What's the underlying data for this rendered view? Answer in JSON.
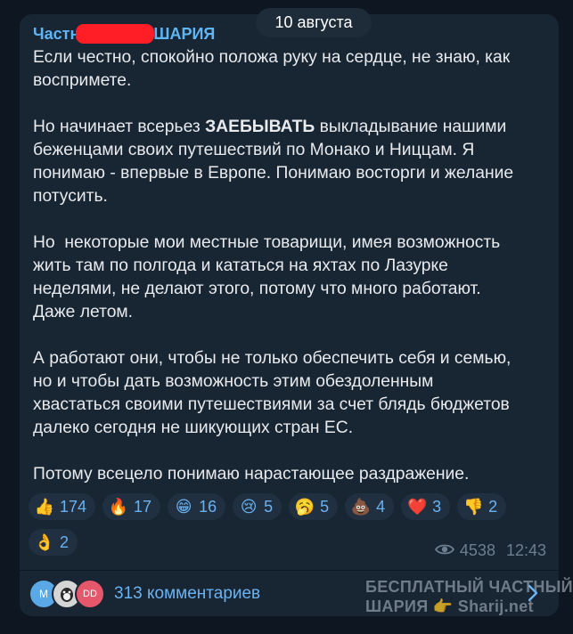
{
  "date": "10 августа",
  "channel": {
    "name_left": "Частн",
    "name_right": "ШАРИЯ"
  },
  "message": {
    "p1": "Если честно, спокойно положа руку на сердце, не знаю, как воспримете.",
    "p2_a": "Но начинает всерьез ",
    "p2_bold": "ЗАЕБЫВАТЬ",
    "p2_b": " выкладывание нашими беженцами своих путешествий по Монако и Ниццам. Я понимаю - впервые в Европе. Понимаю восторги и желание потусить.",
    "p3": "Но  некоторые мои местные товарищи, имея возможность жить там по полгода и кататься на яхтах по Лазурке неделями, не делают этого, потому что много работают. Даже летом.",
    "p4": "А работают они, чтобы не только обеспечить себя и семью, но и чтобы дать возможность этим обездоленным хвастаться своими путешествиями за счет блядь бюджетов далеко сегодня не шикующих стран ЕС.",
    "p5": "Потому всецело понимаю нарастающее раздражение."
  },
  "reactions": [
    {
      "emoji": "thumbs-up",
      "count": "174"
    },
    {
      "emoji": "fire",
      "count": "17"
    },
    {
      "emoji": "grinning-face",
      "count": "16"
    },
    {
      "emoji": "crying-face",
      "count": "5"
    },
    {
      "emoji": "yawning-face",
      "count": "5"
    },
    {
      "emoji": "poop",
      "count": "4"
    },
    {
      "emoji": "red-heart",
      "count": "3"
    },
    {
      "emoji": "thumbs-down",
      "count": "2"
    },
    {
      "emoji": "ok-hand",
      "count": "2"
    }
  ],
  "meta": {
    "views": "4538",
    "time": "12:43"
  },
  "comments": {
    "label": "313 комментариев",
    "avatar1": "M",
    "avatar3": "DD"
  },
  "watermark": {
    "line1": "БЕСПЛАТНЫЙ ЧАСТНЫЙ",
    "line2": "ШАРИЯ 👉 Sharij.net"
  },
  "colors": {
    "background": "#0e1621",
    "bubble": "#182533",
    "accent": "#6ab3f3",
    "channel_name": "#5eb5f7",
    "text": "#e8eaed"
  }
}
